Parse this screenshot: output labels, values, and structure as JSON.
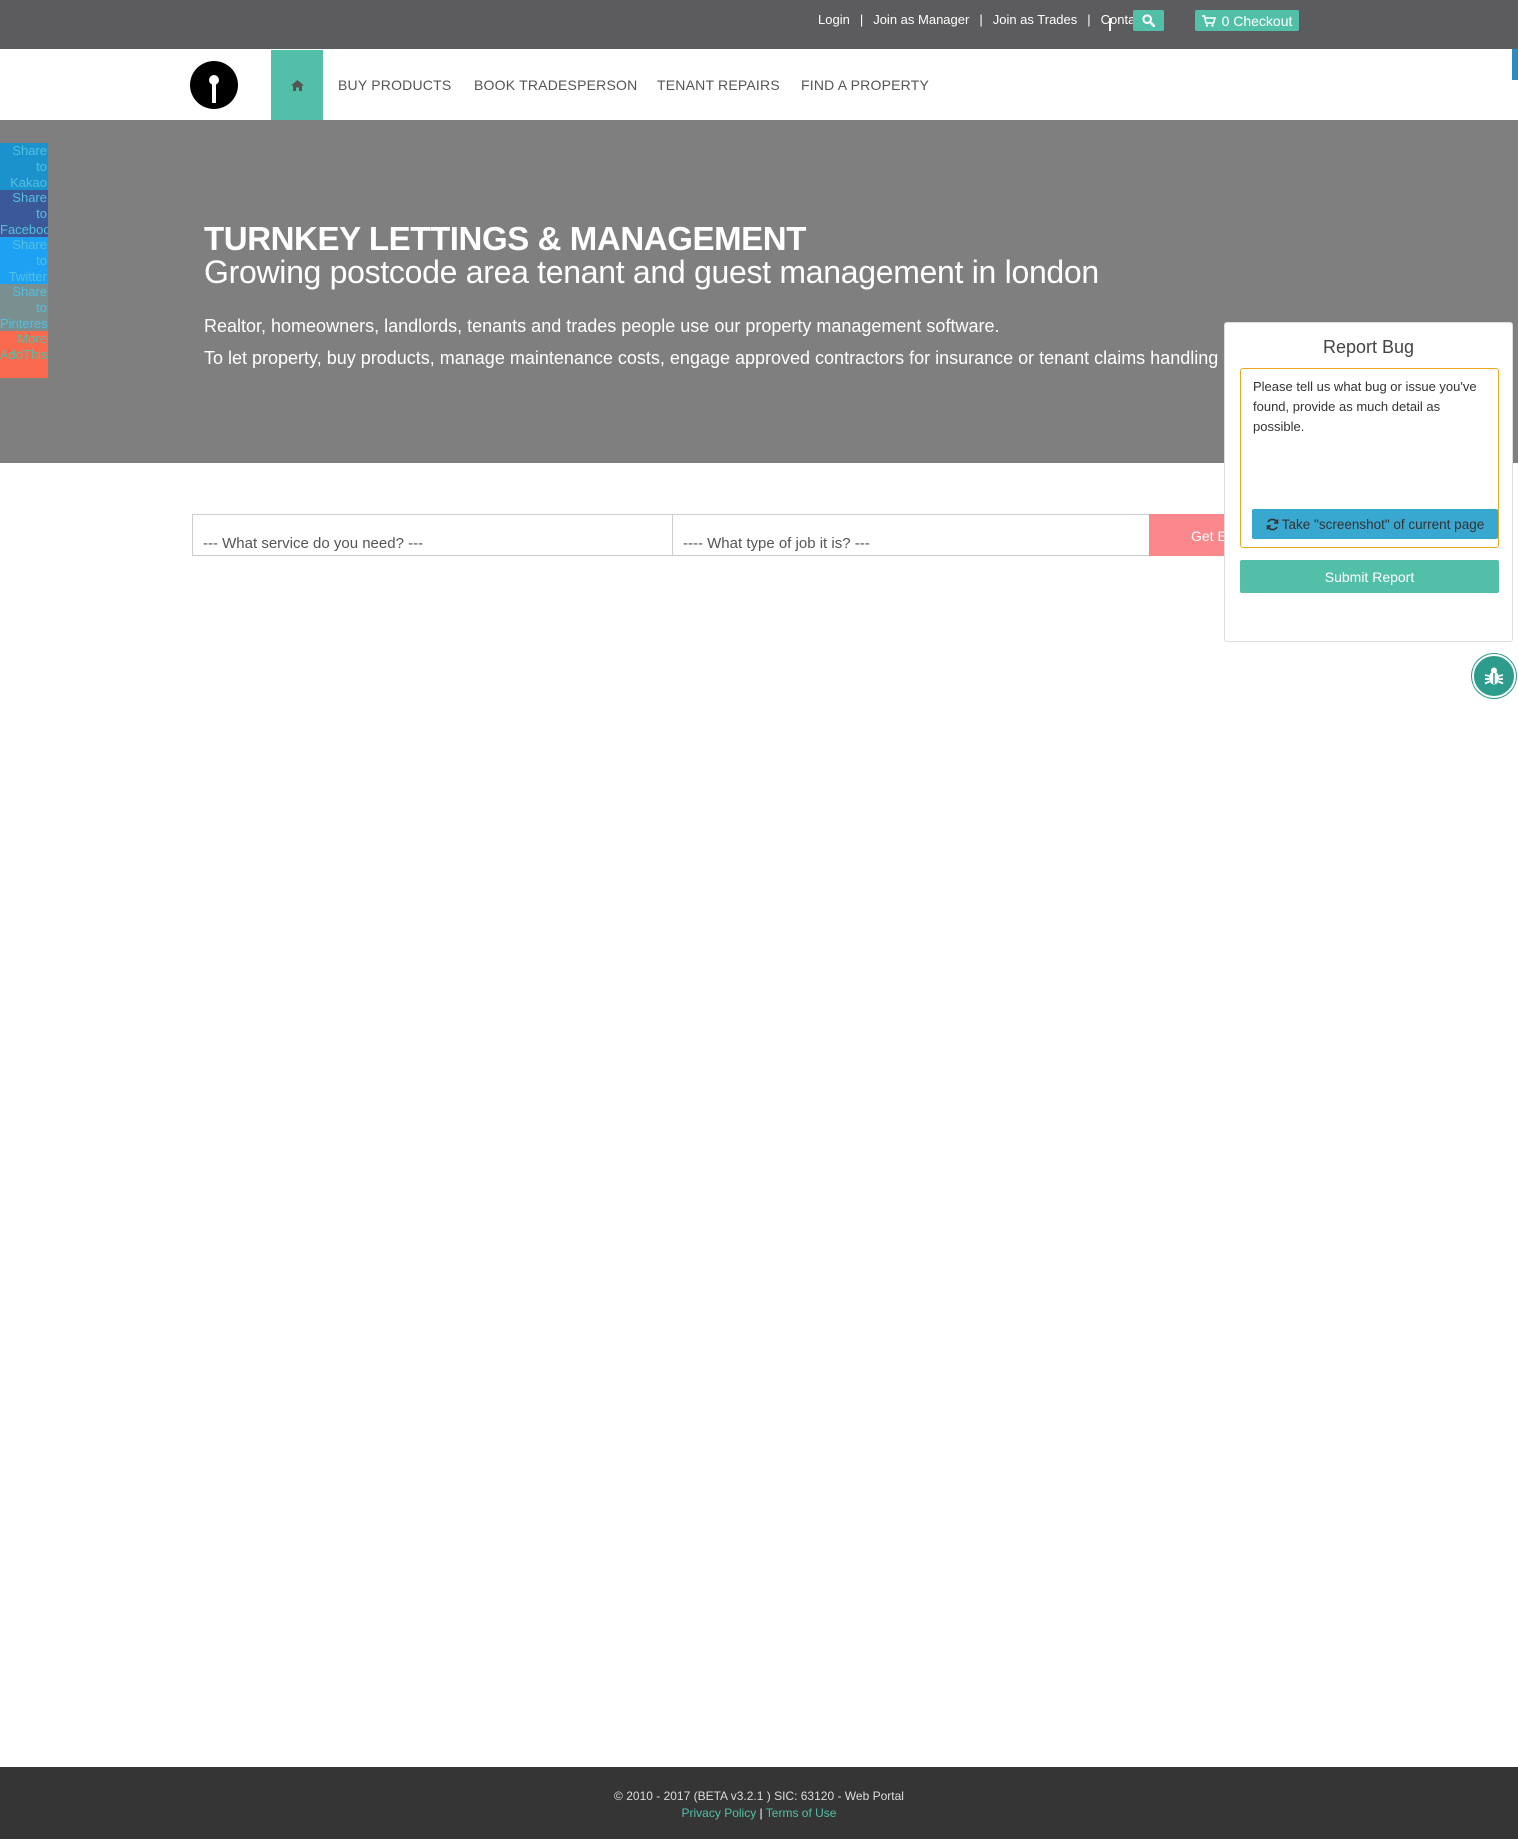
{
  "topbar": {
    "links": [
      "Login",
      "Join as Manager",
      "Join as Trades",
      "Contact"
    ],
    "separator": "|",
    "search_icon": "search-icon",
    "checkout_label": "0 Checkout",
    "cart_icon": "cart-icon"
  },
  "nav": {
    "home_icon": "home-icon",
    "items": [
      "BUY PRODUCTS",
      "BOOK TRADESPERSON",
      "TENANT REPAIRS",
      "FIND A PROPERTY"
    ]
  },
  "share": {
    "items": [
      {
        "label": "Share to Kakao",
        "color": "#1b92cc",
        "text_color": "#52c0e0",
        "icon": "kakao-icon"
      },
      {
        "label": "Share to Facebook",
        "color": "#3b5998",
        "text_color": "#52c0e0",
        "icon": "facebook-icon"
      },
      {
        "label": "Share to Twitter",
        "color": "#1da1f2",
        "text_color": "#52c0e0",
        "icon": "twitter-icon"
      },
      {
        "label": "Share to Pinterest",
        "color": "#7a8f8f",
        "text_color": "#52c0e0",
        "icon": "pinterest-icon"
      },
      {
        "label": "More AddThis",
        "color": "#f8694d",
        "text_color": "#52c0a8",
        "icon": "addthis-icon"
      }
    ]
  },
  "hero": {
    "title": "TURNKEY LETTINGS & MANAGEMENT",
    "subtitle": "Growing postcode area tenant and guest management in london",
    "line1": "Realtor, homeowners, landlords, tenants and trades people use our property management software.",
    "line2": "To let property, buy products, manage maintenance costs, engage approved contractors for insurance or tenant claims handling purposes."
  },
  "service_form": {
    "service_select": "--- What service do you need? ---",
    "job_type_select": "---- What type of job it is? ---",
    "submit_label": "Get E"
  },
  "bug_report": {
    "title": "Report Bug",
    "placeholder": "Please tell us what bug or issue you've found, provide as much detail as possible.",
    "screenshot_label": "Take \"screenshot\" of current page",
    "submit_label": "Submit Report",
    "fab_icon": "bug-icon"
  },
  "footer": {
    "copyright": "© 2010 - 2017 (BETA v3.2.1 ) SIC: 63120 - Web Portal",
    "privacy": "Privacy Policy",
    "separator": "|",
    "terms": "Terms of Use"
  }
}
